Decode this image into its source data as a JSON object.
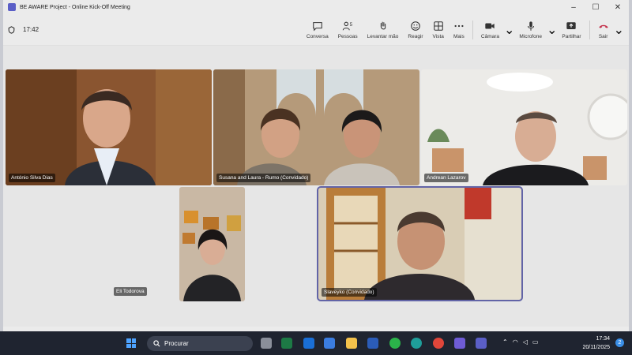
{
  "window": {
    "title": "BE AWARE Project - Online Kick-Off Meeting"
  },
  "toolbar": {
    "timer": "17:42",
    "people_count": "5",
    "items": {
      "chat": "Conversa",
      "people": "Pessoas",
      "raise": "Levantar mão",
      "react": "Reagir",
      "view": "Vista",
      "more": "Mais",
      "camera": "Câmara",
      "mic": "Microfone",
      "share": "Partilhar",
      "leave": "Sair"
    }
  },
  "participants": [
    {
      "name": "António Silva Dias"
    },
    {
      "name": "Susana and Laura - Rumo (Convidado)"
    },
    {
      "name": "Andrean Lazarov"
    },
    {
      "name": "Eli Todorova"
    },
    {
      "name": "Slaveyko (Convidado)"
    }
  ],
  "taskbar": {
    "search_placeholder": "Procurar",
    "time": "17:34",
    "date": "20/11/2025",
    "notifications": "2"
  },
  "colors": {
    "accent": "#6264a7",
    "leave": "#c4314b",
    "taskbar": "#1f2430"
  }
}
